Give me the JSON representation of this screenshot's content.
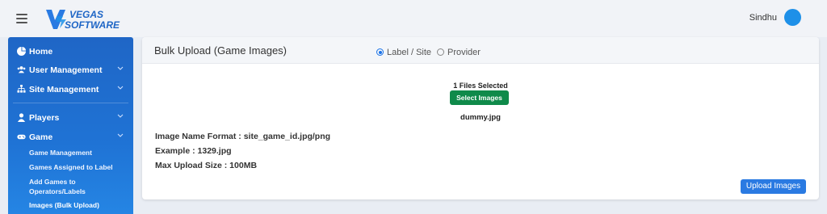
{
  "header": {
    "logo_line1": "VEGAS",
    "logo_line2": "SOFTWARE",
    "user_name": "Sindhu",
    "icons": {
      "menu": "hamburger-icon",
      "avatar": "user-avatar"
    }
  },
  "sidebar": {
    "items": [
      {
        "label": "Home",
        "icon": "pie-chart-icon"
      },
      {
        "label": "User Management",
        "icon": "users-icon"
      },
      {
        "label": "Site Management",
        "icon": "sitemap-icon"
      },
      {
        "label": "Players",
        "icon": "user-icon"
      },
      {
        "label": "Game",
        "icon": "gamepad-icon"
      }
    ],
    "game_subitems": [
      "Game Management",
      "Games Assigned to Label",
      "Add Games to",
      "Operators/Labels",
      "Images (Bulk Upload)"
    ]
  },
  "card": {
    "title": "Bulk Upload (Game Images)",
    "radio_options": [
      "Label / Site",
      "Provider"
    ],
    "selected_option": "Label / Site",
    "files_selected": "1 Files Selected",
    "select_button": "Select Images",
    "file_name": "dummy.jpg",
    "info": [
      "Image Name Format : site_game_id.jpg/png",
      "Example : 1329.jpg",
      "Max Upload Size : 100MB"
    ],
    "upload_button": "Upload Images"
  },
  "colors": {
    "sidebar": "#1f6fd0",
    "select_button": "#0f8a4a",
    "upload_button": "#2a7ae2",
    "avatar": "#1e90e8"
  }
}
